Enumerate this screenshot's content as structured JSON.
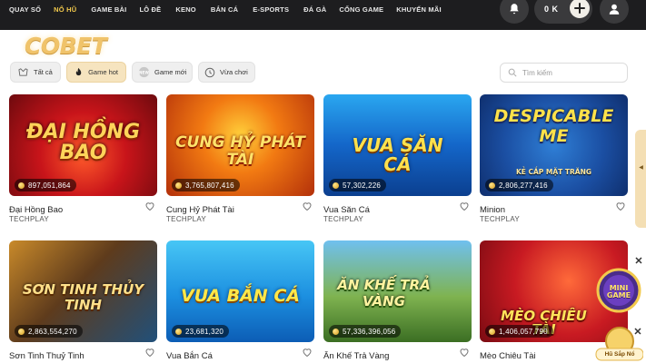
{
  "nav": {
    "items": [
      {
        "label": "QUAY SỐ"
      },
      {
        "label": "NỔ HŨ",
        "active": true
      },
      {
        "label": "GAME BÀI"
      },
      {
        "label": "LÔ ĐỀ"
      },
      {
        "label": "KENO"
      },
      {
        "label": "BẮN CÁ"
      },
      {
        "label": "E-SPORTS"
      },
      {
        "label": "ĐÁ GÀ"
      },
      {
        "label": "CỔNG GAME"
      },
      {
        "label": "KHUYẾN MÃI"
      }
    ],
    "balance": "0 K"
  },
  "logo": "COBET",
  "filters": {
    "chips": [
      {
        "label": "Tất cả",
        "icon": "grid-icon"
      },
      {
        "label": "Game hot",
        "icon": "flame-icon",
        "active": true
      },
      {
        "label": "Game mới",
        "icon": "new-badge-icon"
      },
      {
        "label": "Vừa chơi",
        "icon": "clock-icon"
      }
    ],
    "search_placeholder": "Tìm kiếm"
  },
  "games": [
    {
      "name": "Đại Hồng Bao",
      "provider": "TECHPLAY",
      "jackpot": "897,051,864",
      "art_title": "ĐẠI HỒNG BAO"
    },
    {
      "name": "Cung Hỷ Phát Tài",
      "provider": "TECHPLAY",
      "jackpot": "3,765,807,416",
      "art_title": "CUNG HỶ PHÁT TÀI"
    },
    {
      "name": "Vua Săn Cá",
      "provider": "TECHPLAY",
      "jackpot": "57,302,226",
      "art_title": "VUA SĂN CÁ"
    },
    {
      "name": "Minion",
      "provider": "TECHPLAY",
      "jackpot": "2,806,277,416",
      "art_title": "DESPICABLE ME",
      "art_subtitle": "KẺ CẮP MẶT TRĂNG"
    },
    {
      "name": "Sơn Tinh Thuỷ Tinh",
      "provider": "",
      "jackpot": "2,863,554,270",
      "art_title": "SƠN TINH THỦY TINH"
    },
    {
      "name": "Vua Bắn Cá",
      "provider": "",
      "jackpot": "23,681,320",
      "art_title": "VUA BẮN CÁ"
    },
    {
      "name": "Ăn Khế Trả Vàng",
      "provider": "",
      "jackpot": "57,336,396,056",
      "art_title": "ĂN KHẾ TRẢ VÀNG"
    },
    {
      "name": "Mèo Chiêu Tài",
      "provider": "",
      "jackpot": "1,406,057,790",
      "art_title": "MÈO CHIÊU TÀI"
    }
  ],
  "mini_game": {
    "title": "MINI GAME",
    "label": "Hũ Sắp Nổ"
  },
  "colors": {
    "accent": "#f2c94c",
    "topbar": "#1d1d1f",
    "chip_active": "#f6e4bf"
  }
}
